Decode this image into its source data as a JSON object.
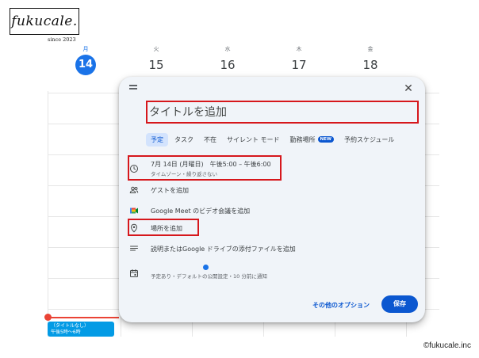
{
  "logo": {
    "text": "fukucale.",
    "sub": "since 2023"
  },
  "calendar": {
    "days": [
      {
        "weekday": "月",
        "number": "14",
        "today": true
      },
      {
        "weekday": "火",
        "number": "15",
        "today": false
      },
      {
        "weekday": "水",
        "number": "16",
        "today": false
      },
      {
        "weekday": "木",
        "number": "17",
        "today": false
      },
      {
        "weekday": "金",
        "number": "18",
        "today": false
      },
      {
        "weekday": "",
        "number": "",
        "today": false
      }
    ],
    "event": {
      "line1": "（タイトルなし）",
      "line2": "午後5時〜6時"
    }
  },
  "dialog": {
    "title_placeholder": "タイトルを追加",
    "tabs": [
      {
        "label": "予定",
        "active": true
      },
      {
        "label": "タスク",
        "active": false
      },
      {
        "label": "不在",
        "active": false
      },
      {
        "label": "サイレント モード",
        "active": false
      },
      {
        "label": "勤務場所",
        "active": false,
        "badge": "NEW"
      },
      {
        "label": "予約スケジュール",
        "active": false
      }
    ],
    "datetime": {
      "main": "7月 14日 (月曜日)　午後5:00 – 午後6:00",
      "sub": "タイムゾーン・繰り返さない"
    },
    "guests": "ゲストを追加",
    "meet": "Google Meet のビデオ会議を追加",
    "location": "場所を追加",
    "description": "説明またはGoogle ドライブの添付ファイルを追加",
    "calendar_info": "予定あり・デフォルトの公開設定・10 分前に通知",
    "more_options": "その他のオプション",
    "save": "保存"
  },
  "copyright": "©fukucale.inc",
  "colors": {
    "accent": "#1a73e8",
    "highlight": "#d6171c",
    "dialog_bg": "#f0f4f9",
    "save": "#0b57d0"
  }
}
